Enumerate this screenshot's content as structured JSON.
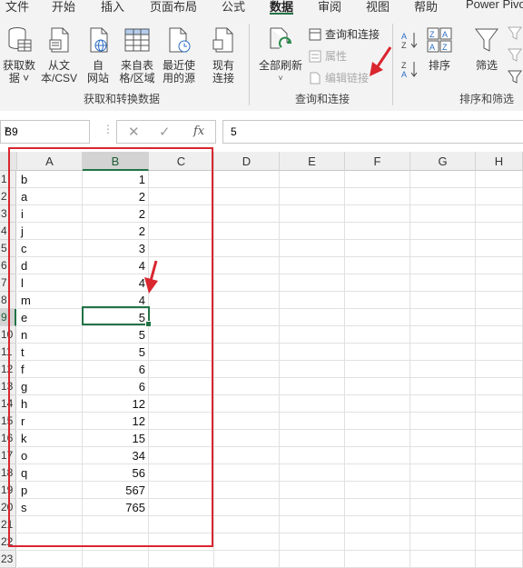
{
  "tabs": [
    "文件",
    "开始",
    "插入",
    "页面布局",
    "公式",
    "数据",
    "审阅",
    "视图",
    "帮助",
    "Power Pivot"
  ],
  "active_tab": "数据",
  "ribbon": {
    "get_data": "获取数\n据 ˅",
    "from_csv": "从文\n本/CSV",
    "from_web": "自\n网站",
    "from_table": "来自表\n格/区域",
    "recent_sources": "最近使\n用的源",
    "existing_conn": "现有\n连接",
    "group1_label": "获取和转换数据",
    "refresh_all": "全部刷新",
    "queries_conn": "查询和连接",
    "properties": "属性",
    "edit_links": "编辑链接",
    "group2_label": "查询和连接",
    "sort": "排序",
    "filter": "筛选",
    "group3_label": "排序和筛选"
  },
  "formula_bar": {
    "name_box": "B9",
    "cancel": "✕",
    "enter": "✓",
    "fx": "fx",
    "value": "5"
  },
  "columns": [
    "A",
    "B",
    "C",
    "D",
    "E",
    "F",
    "G",
    "H"
  ],
  "selected_cell": "B9",
  "rows": [
    {
      "n": "1",
      "a": "b",
      "b": "1"
    },
    {
      "n": "2",
      "a": "a",
      "b": "2"
    },
    {
      "n": "3",
      "a": "i",
      "b": "2"
    },
    {
      "n": "4",
      "a": "j",
      "b": "2"
    },
    {
      "n": "5",
      "a": "c",
      "b": "3"
    },
    {
      "n": "6",
      "a": "d",
      "b": "4"
    },
    {
      "n": "7",
      "a": "l",
      "b": "4"
    },
    {
      "n": "8",
      "a": "m",
      "b": "4"
    },
    {
      "n": "9",
      "a": "e",
      "b": "5"
    },
    {
      "n": "10",
      "a": "n",
      "b": "5"
    },
    {
      "n": "11",
      "a": "t",
      "b": "5"
    },
    {
      "n": "12",
      "a": "f",
      "b": "6"
    },
    {
      "n": "13",
      "a": "g",
      "b": "6"
    },
    {
      "n": "14",
      "a": "h",
      "b": "12"
    },
    {
      "n": "15",
      "a": "r",
      "b": "12"
    },
    {
      "n": "16",
      "a": "k",
      "b": "15"
    },
    {
      "n": "17",
      "a": "o",
      "b": "34"
    },
    {
      "n": "18",
      "a": "q",
      "b": "56"
    },
    {
      "n": "19",
      "a": "p",
      "b": "567"
    },
    {
      "n": "20",
      "a": "s",
      "b": "765"
    },
    {
      "n": "21",
      "a": "",
      "b": ""
    },
    {
      "n": "22",
      "a": "",
      "b": ""
    },
    {
      "n": "23",
      "a": "",
      "b": ""
    }
  ],
  "colors": {
    "excel_green": "#217346",
    "annotation_red": "#d9262f"
  }
}
